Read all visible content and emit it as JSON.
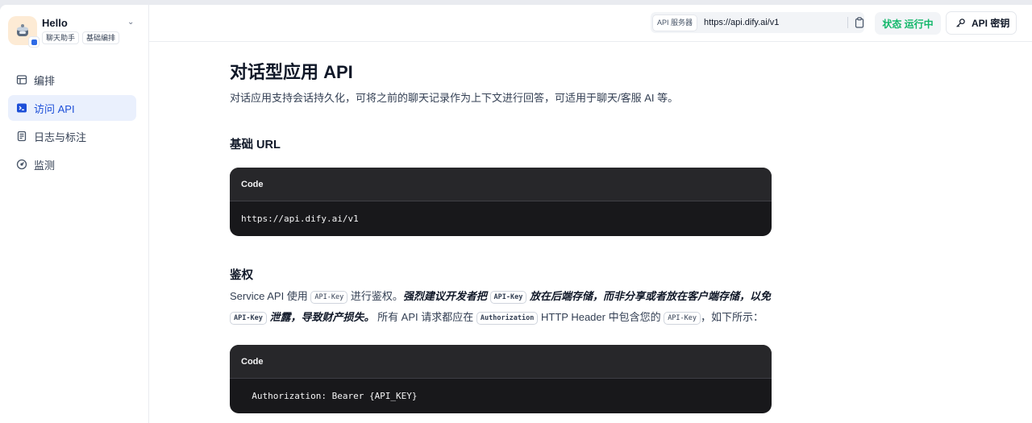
{
  "app": {
    "name": "Hello",
    "tags": [
      "聊天助手",
      "基础编排"
    ]
  },
  "sidebar": {
    "items": [
      {
        "label": "编排",
        "icon": "layout-icon",
        "active": false
      },
      {
        "label": "访问 API",
        "icon": "terminal-icon",
        "active": true
      },
      {
        "label": "日志与标注",
        "icon": "file-list-icon",
        "active": false
      },
      {
        "label": "监测",
        "icon": "gauge-icon",
        "active": false
      }
    ]
  },
  "topbar": {
    "server_label": "API 服务器",
    "server_url": "https://api.dify.ai/v1",
    "status_label": "状态",
    "status_value": "运行中",
    "key_button": "API 密钥"
  },
  "content": {
    "title": "对话型应用 API",
    "description": "对话应用支持会话持久化，可将之前的聊天记录作为上下文进行回答，可适用于聊天/客服 AI 等。",
    "base_url_heading": "基础 URL",
    "code1": {
      "header": "Code",
      "body": "https://api.dify.ai/v1"
    },
    "auth_heading": "鉴权",
    "auth_line1": {
      "t1": "Service API 使用 ",
      "code1": "API-Key",
      "t2": " 进行鉴权。",
      "em1": "强烈建议开发者把 ",
      "code2": "API-Key",
      "em2": " 放在后端存储，而非分享或者放在客户端存储，以免"
    },
    "auth_line2": {
      "code1": "API-Key",
      "em1": " 泄露，导致财产损失。",
      "t1": " 所有 API 请求都应在 ",
      "code2": "Authorization",
      "t2": " HTTP Header 中包含您的 ",
      "code3": "API-Key",
      "t3": "，如下所示："
    },
    "code2": {
      "header": "Code",
      "body": "  Authorization: Bearer {API_KEY}"
    }
  },
  "colors": {
    "accent": "#1d4fd8",
    "status_green": "#12b76a",
    "code_bg": "#18181b"
  }
}
